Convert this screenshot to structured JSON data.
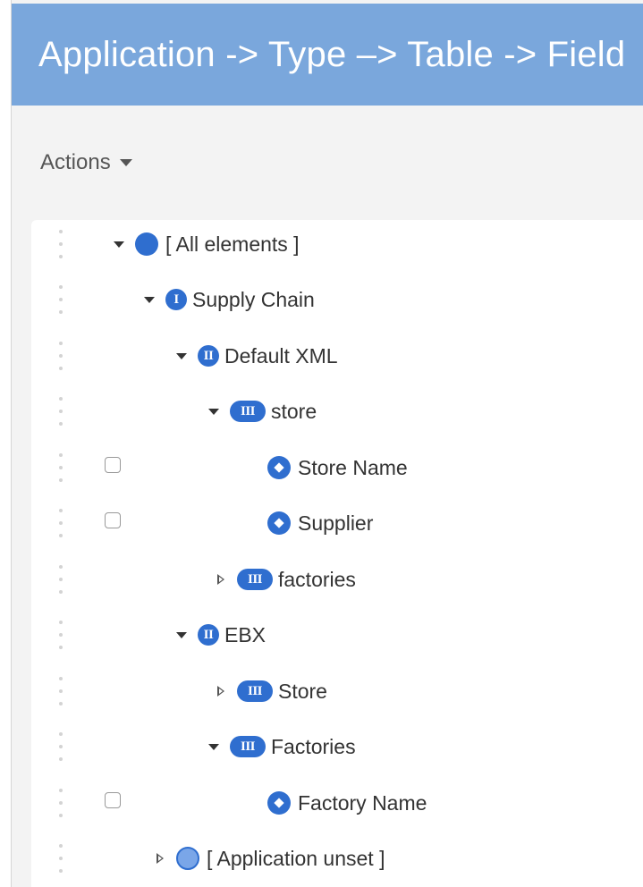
{
  "header": {
    "title": "Application -> Type –> Table -> Field"
  },
  "toolbar": {
    "actions_label": "Actions"
  },
  "tree": {
    "rows": [
      {
        "label": "[ All elements ]",
        "icon": "filled-circle-icon"
      },
      {
        "label": "Supply Chain",
        "badge": "I"
      },
      {
        "label": "Default XML",
        "badge": "II"
      },
      {
        "label": "store",
        "badge": "III"
      },
      {
        "label": "Store Name",
        "icon": "field-diamond-icon"
      },
      {
        "label": "Supplier",
        "icon": "field-diamond-icon"
      },
      {
        "label": "factories",
        "badge": "III"
      },
      {
        "label": "EBX",
        "badge": "II"
      },
      {
        "label": "Store",
        "badge": "III"
      },
      {
        "label": "Factories",
        "badge": "III"
      },
      {
        "label": "Factory Name",
        "icon": "field-diamond-icon"
      },
      {
        "label": "[ Application unset ]",
        "icon": "light-circle-icon"
      }
    ]
  },
  "colors": {
    "header_bg": "#7aa7dc",
    "badge_blue": "#2f6ecf",
    "page_bg": "#f3f3f3"
  }
}
